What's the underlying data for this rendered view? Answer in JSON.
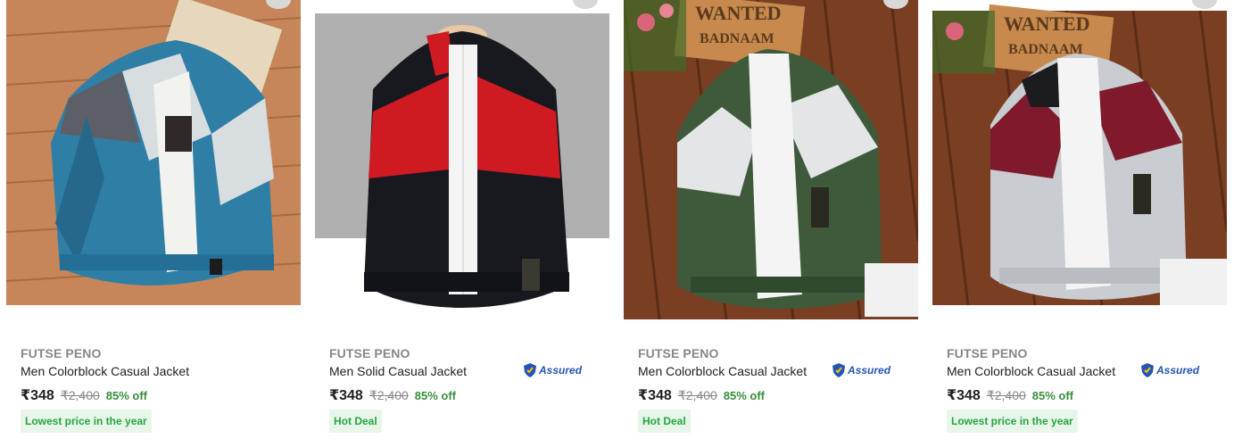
{
  "products": [
    {
      "brand": "FUTSE PENO",
      "title": "Men Colorblock Casual Jacket",
      "assured": "",
      "price": "₹348",
      "mrp": "₹2,400",
      "discount": "85% off",
      "tag": "Lowest price in the year",
      "image": {
        "background": "wooden-planks",
        "colors": [
          "#2e7ea6",
          "#d8dde0",
          "#5c6066"
        ]
      }
    },
    {
      "brand": "FUTSE PENO",
      "title": "Men Solid Casual Jacket",
      "assured": "Assured",
      "price": "₹348",
      "mrp": "₹2,400",
      "discount": "85% off",
      "tag": "Hot Deal",
      "image": {
        "background": "grey-studio",
        "colors": [
          "#17191f",
          "#d01a22",
          "#ffffff"
        ]
      }
    },
    {
      "brand": "FUTSE PENO",
      "title": "Men Colorblock Casual Jacket",
      "assured": "Assured",
      "price": "₹348",
      "mrp": "₹2,400",
      "discount": "85% off",
      "tag": "Hot Deal",
      "image": {
        "background": "wooden-planks",
        "colors": [
          "#3f5a3a",
          "#e3e5e6",
          "#1f2a1e"
        ]
      }
    },
    {
      "brand": "FUTSE PENO",
      "title": "Men Colorblock Casual Jacket",
      "assured": "Assured",
      "price": "₹348",
      "mrp": "₹2,400",
      "discount": "85% off",
      "tag": "Lowest price in the year",
      "image": {
        "background": "wooden-planks",
        "colors": [
          "#7e1a2b",
          "#c9ccd0",
          "#1c1c1e"
        ]
      }
    }
  ],
  "poster_text": [
    "WANTED",
    "BADNAAM"
  ],
  "colors": {
    "discount": "#388e3c",
    "tag_bg": "#e7f6e9",
    "tag_text": "#26a541",
    "assured": "#2455b6"
  }
}
